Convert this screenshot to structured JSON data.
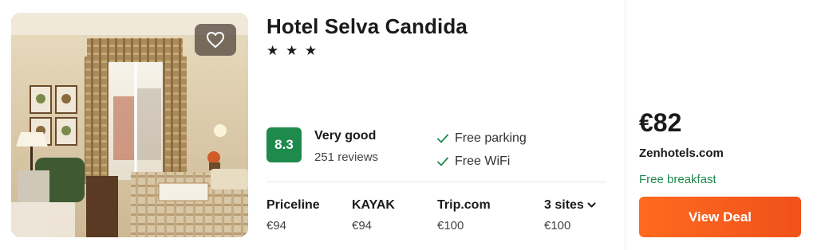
{
  "hotel": {
    "name": "Hotel Selva Candida",
    "stars": "★ ★ ★",
    "star_count": 3
  },
  "rating": {
    "score": "8.3",
    "label": "Very good",
    "reviews": "251 reviews",
    "color": "#1e8a4c"
  },
  "amenities": [
    {
      "label": "Free parking",
      "icon": "check-icon"
    },
    {
      "label": "Free WiFi",
      "icon": "check-icon"
    }
  ],
  "providers": [
    {
      "name": "Priceline",
      "price": "€94"
    },
    {
      "name": "KAYAK",
      "price": "€94"
    },
    {
      "name": "Trip.com",
      "price": "€100"
    },
    {
      "name": "3 sites",
      "price": "€100",
      "icon": "chevron-down-icon"
    }
  ],
  "deal": {
    "price": "€82",
    "provider": "Zenhotels.com",
    "extra": "Free breakfast",
    "button_label": "View Deal",
    "button_color": "#f55f1c"
  },
  "favorite": {
    "icon": "heart-icon"
  }
}
